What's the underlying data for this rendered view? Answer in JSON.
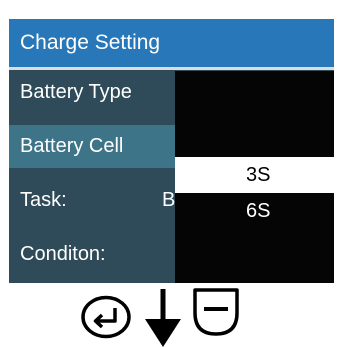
{
  "screen": {
    "title": "Charge Setting",
    "rows": [
      {
        "label": "Battery Type",
        "value": ""
      },
      {
        "label": "Battery Cell",
        "value": ""
      },
      {
        "label": "Task:",
        "value": "B"
      },
      {
        "label": "Conditon:",
        "value": ""
      }
    ],
    "selected_row": "Battery Cell"
  },
  "dropdown": {
    "options": [
      "3S",
      "6S"
    ],
    "highlighted": "3S"
  },
  "controls": {
    "icons": [
      "enter-icon",
      "down-arrow-icon",
      "minus-icon"
    ]
  },
  "colors": {
    "title_bar": "#2878b9",
    "screen_bg": "#2f4a58",
    "selected_row": "#3e7487",
    "dropdown_bg": "#050505",
    "highlight_bg": "#ffffff"
  }
}
